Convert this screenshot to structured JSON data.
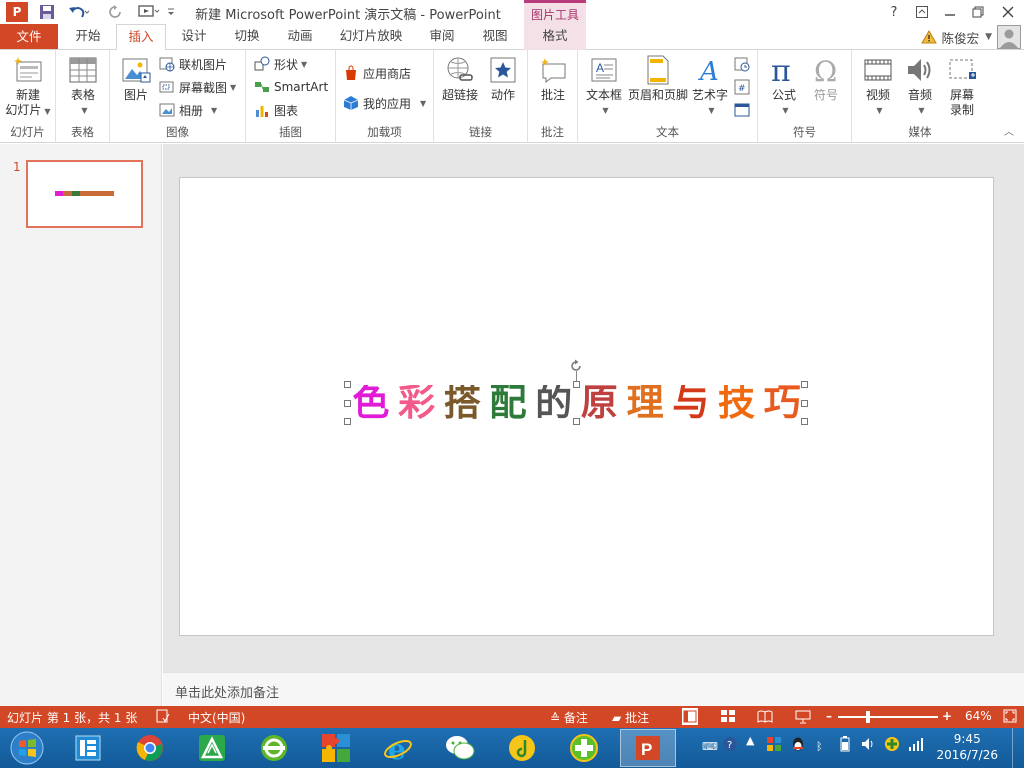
{
  "window": {
    "title": "新建 Microsoft PowerPoint 演示文稿 - PowerPoint",
    "context_tab_title": "图片工具",
    "logo_letter": "P",
    "help": "?"
  },
  "tabs": [
    {
      "label": "文件"
    },
    {
      "label": "开始"
    },
    {
      "label": "插入"
    },
    {
      "label": "设计"
    },
    {
      "label": "切换"
    },
    {
      "label": "动画"
    },
    {
      "label": "幻灯片放映"
    },
    {
      "label": "审阅"
    },
    {
      "label": "视图"
    },
    {
      "label": "格式"
    }
  ],
  "user": {
    "name": "陈俊宏"
  },
  "ribbon": {
    "groups": {
      "slides": "幻灯片",
      "tables": "表格",
      "images": "图像",
      "illustrations": "插图",
      "addins": "加载项",
      "links": "链接",
      "comments": "批注",
      "text": "文本",
      "symbols": "符号",
      "media": "媒体"
    },
    "new_slide_line1": "新建",
    "new_slide_line2": "幻灯片",
    "table": "表格",
    "picture": "图片",
    "online_pictures": "联机图片",
    "screenshot": "屏幕截图",
    "photo_album": "相册",
    "shapes": "形状",
    "smartart": "SmartArt",
    "chart": "图表",
    "store": "应用商店",
    "my_apps": "我的应用",
    "hyperlink": "超链接",
    "action": "动作",
    "comment": "批注",
    "textbox": "文本框",
    "header_footer": "页眉和页脚",
    "wordart": "艺术字",
    "equation": "公式",
    "symbol": "符号",
    "video": "视频",
    "audio": "音频",
    "screen_rec_line1": "屏幕",
    "screen_rec_line2": "录制"
  },
  "thumbnail": {
    "number": "1"
  },
  "slide": {
    "title_text": "色彩搭配的原理与技巧",
    "title_colors": [
      "#e21bd6",
      "#f25a8a",
      "#7a5a2a",
      "#2e7a3a",
      "#555555",
      "#c04040",
      "#e07020",
      "#d43a1a",
      "#f06a10",
      "#e85a20"
    ]
  },
  "notes_placeholder": "单击此处添加备注",
  "status": {
    "slide_info": "幻灯片 第 1 张，共 1 张",
    "language": "中文(中国)",
    "notes_btn": "备注",
    "comments_btn": "批注",
    "zoom": "64%",
    "zoom_fraction": 0.64
  },
  "taskbar": {
    "time": "9:45",
    "date": "2016/7/26"
  }
}
